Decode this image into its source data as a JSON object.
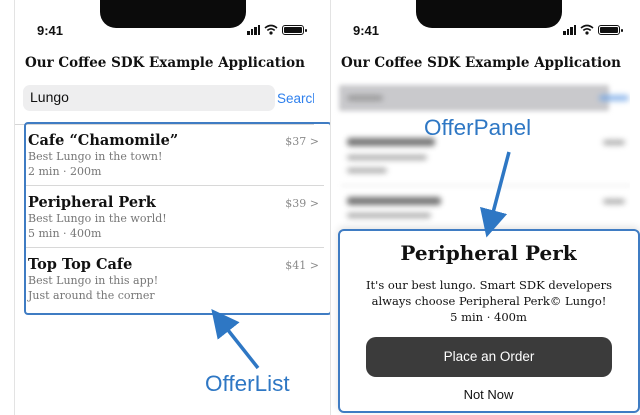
{
  "status_bar": {
    "time": "9:41"
  },
  "app": {
    "title": "Our Coffee SDK Example Application"
  },
  "search": {
    "value": "Lungo",
    "button_label": "Search"
  },
  "offers": [
    {
      "name": "Cafe “Chamomile”",
      "description": "Best Lungo in the town!",
      "meta": "2 min · 200m",
      "price": "$37 >"
    },
    {
      "name": "Peripheral Perk",
      "description": "Best Lungo in the world!",
      "meta": "5 min · 400m",
      "price": "$39 >"
    },
    {
      "name": "Top Top Cafe",
      "description": "Best Lungo in this app!",
      "meta": "Just around the corner",
      "price": "$41 >"
    }
  ],
  "offer_panel": {
    "title": "Peripheral Perk",
    "description": "It's our best lungo. Smart SDK developers always choose Peripheral Perk© Lungo!",
    "meta": "5 min · 400m",
    "order_button": "Place an Order",
    "dismiss_button": "Not Now"
  },
  "annotations": {
    "offer_list": "OfferList",
    "offer_panel": "OfferPanel",
    "color": "#2e77c4"
  },
  "icons": [
    "signal-icon",
    "wifi-icon",
    "battery-icon"
  ]
}
